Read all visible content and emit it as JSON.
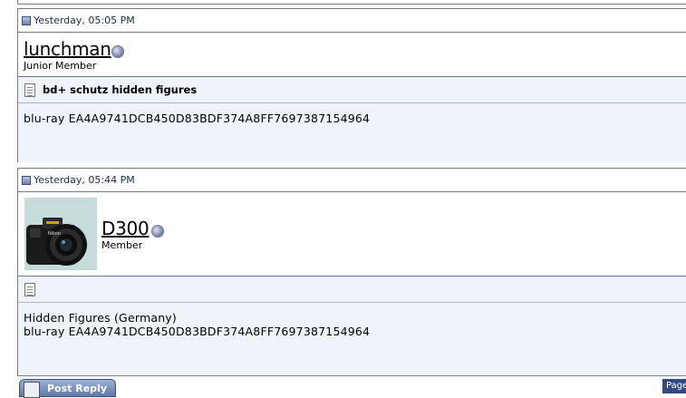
{
  "posts": [
    {
      "timestamp": "Yesterday, 05:05 PM",
      "username": "lunchman",
      "user_title": "Junior Member",
      "has_avatar": false,
      "title": "bd+ schutz hidden figures",
      "body": "blu-ray EA4A9741DCB450D83BDF374A8FF7697387154964"
    },
    {
      "timestamp": "Yesterday, 05:44 PM",
      "username": "D300",
      "user_title": "Member",
      "has_avatar": true,
      "avatar_icon": "camera-avatar",
      "title": "",
      "body_line1": "Hidden Figures (Germany)",
      "body_line2": "blu-ray EA4A9741DCB450D83BDF374A8FF7697387154964"
    }
  ],
  "footer": {
    "post_reply_label": "Post Reply",
    "pager_label": "Page"
  },
  "colors": {
    "border": "#6b7b94",
    "message_bg": "#eef3fc",
    "button_bg": "#5f78a8"
  }
}
